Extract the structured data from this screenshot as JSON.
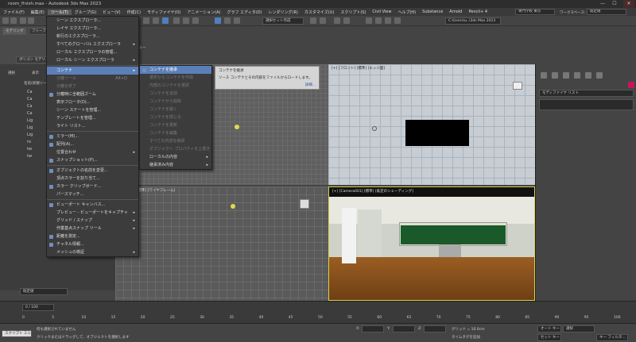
{
  "title": "room_finish.max - Autodesk 3ds Max 2023",
  "window_controls": {
    "minimize": "—",
    "maximize": "☐",
    "close": "✕"
  },
  "menubar": [
    "ファイル(F)",
    "編集(E)",
    "ツール(T)",
    "グループ(G)",
    "ビュー(V)",
    "作成(C)",
    "モディファイヤ(O)",
    "アニメーション(A)",
    "グラフ エディタ(D)",
    "レンダリング(R)",
    "カスタマイズ(U)",
    "スクリプト(S)",
    "Civil View",
    "ヘルプ(H)",
    "Substance",
    "Arnold",
    "Pencil+ 4"
  ],
  "workspace": {
    "user": "専門学校 東京",
    "label": "ワークスペース:",
    "value": "既定値"
  },
  "toolbar": {
    "selection_set": "選択セット作成",
    "path": "C:\\Users\\u..\\3ds Max 2023",
    "view_dropdown": "ビュー"
  },
  "ribbon": {
    "tab1": "モデリング",
    "tab2": "フリーフ",
    "polygon_modeling": "ポリゴン モデリング"
  },
  "scene_explorer": {
    "tabs": [
      "選択",
      "表示"
    ],
    "header": "名前(昇順ソート)",
    "rows": [
      "Ca",
      "Ca",
      "Ca",
      "Ca",
      "Lig",
      "Lig",
      "Lig",
      "ro",
      "tw",
      "tw"
    ],
    "mode": "既定値",
    "status": "0 / 100"
  },
  "tools_menu": {
    "items": [
      {
        "label": "シーン エクスプローラ...",
        "type": "item"
      },
      {
        "label": "レイヤ エクスプローラ...",
        "type": "item"
      },
      {
        "label": "新行のエクスプローラ...",
        "type": "item"
      },
      {
        "label": "すべてのグローバル エクスプローラ",
        "type": "submenu"
      },
      {
        "label": "ローカル エクスプローラの管理...",
        "type": "item"
      },
      {
        "label": "ローカル シーン エクスプローラ",
        "type": "submenu"
      },
      {
        "type": "sep"
      },
      {
        "label": "コンテナ",
        "type": "submenu",
        "highlight": true
      },
      {
        "label": "分離ツール",
        "type": "disabled",
        "shortcut": "Alt+Q"
      },
      {
        "label": "分離を終了",
        "type": "disabled"
      },
      {
        "label": "分離時に全範囲ズーム",
        "type": "check"
      },
      {
        "label": "表示フロータ(D)...",
        "type": "item"
      },
      {
        "label": "シーン ステートを管理...",
        "type": "item"
      },
      {
        "label": "テンプレートを管理...",
        "type": "item"
      },
      {
        "label": "ライト リスト...",
        "type": "item"
      },
      {
        "type": "sep"
      },
      {
        "label": "ミラー(M)...",
        "type": "icon"
      },
      {
        "label": "配列(A)...",
        "type": "icon"
      },
      {
        "label": "位置合わせ",
        "type": "submenu"
      },
      {
        "label": "スナップショット(P)...",
        "type": "icon"
      },
      {
        "type": "sep"
      },
      {
        "label": "オブジェクトの名前を変更...",
        "type": "icon"
      },
      {
        "label": "頂点カラーを割り当て...",
        "type": "item"
      },
      {
        "label": "カラー クリップボード...",
        "type": "icon"
      },
      {
        "label": "パースマッチ...",
        "type": "item"
      },
      {
        "type": "sep"
      },
      {
        "label": "ビューポート キャンバス...",
        "type": "icon"
      },
      {
        "label": "プレビュー - ビューポートをキャプチャ",
        "type": "submenu"
      },
      {
        "label": "グリッド / スナップ",
        "type": "submenu"
      },
      {
        "label": "作業基点スナップ ツール",
        "type": "submenu"
      },
      {
        "label": "距離を測定...",
        "type": "icon"
      },
      {
        "label": "チャネル情報...",
        "type": "icon"
      },
      {
        "label": "メッシュの検証",
        "type": "submenu"
      }
    ]
  },
  "container_menu": {
    "items": [
      {
        "label": "コンテナを継承",
        "type": "icon",
        "highlight": true
      },
      {
        "label": "選択からコンテナを作成",
        "type": "disabled"
      },
      {
        "label": "内部のコンテナを選択",
        "type": "disabled"
      },
      {
        "label": "コンテナを追加",
        "type": "disabled"
      },
      {
        "label": "コンテナから削除",
        "type": "disabled"
      },
      {
        "label": "コンテナを開く",
        "type": "disabled"
      },
      {
        "label": "コンテナを閉じる",
        "type": "disabled"
      },
      {
        "label": "コンテナを更新",
        "type": "disabled"
      },
      {
        "label": "コンテナを編集",
        "type": "disabled"
      },
      {
        "label": "すべての内容を継承",
        "type": "disabled"
      },
      {
        "label": "オブジェクト プロパティを上書き",
        "type": "disabled"
      },
      {
        "label": "ローカルの内容",
        "type": "submenu"
      },
      {
        "label": "継承済み内容",
        "type": "submenu"
      }
    ]
  },
  "tooltip": {
    "title": "コンテナを継承",
    "body": "ソース コンテナとその内容をファイルからロードします。",
    "more": "詳細..."
  },
  "viewports": {
    "top_left": "[+] [トップ] [標準] [ワイヤフレーム]",
    "top_right": "[+] [フロント] [標準] [エッジ面]",
    "bottom_left": "[+] [透視] [標準] [ワイヤフレーム]",
    "bottom_right": "[+] [Camera001] [標準] [既定のシェーディング]"
  },
  "command_panel": {
    "modifier_list": "モディファイヤ リスト"
  },
  "timeline": {
    "frame": "0 / 100",
    "ticks": [
      "0",
      "5",
      "10",
      "15",
      "20",
      "25",
      "30",
      "35",
      "40",
      "45",
      "50",
      "55",
      "60",
      "65",
      "70",
      "75",
      "80",
      "85",
      "90",
      "95",
      "100"
    ]
  },
  "status": {
    "script": "スクリプト ミニ リス",
    "line1": "何も選択されていません",
    "line2": "クリックまたはドラッグして、オブジェクトを選択します",
    "x_label": "X:",
    "y_label": "Y:",
    "z_label": "Z:",
    "grid": "グリッド = 10.0cm",
    "add_time_tag": "タイムタグを追加",
    "auto_key": "オート キー",
    "set_key": "セット キー",
    "selection": "選択",
    "key_filter": "キー フィルタ..."
  }
}
